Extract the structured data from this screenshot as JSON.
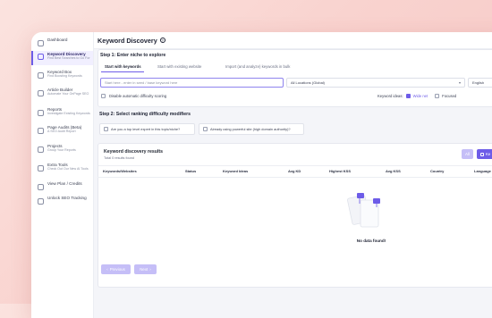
{
  "sidebar": {
    "items": [
      {
        "title": "Dashboard",
        "sub": ""
      },
      {
        "title": "Keyword Discovery",
        "sub": "Find Best Searches to Go For"
      },
      {
        "title": "Keyword Box",
        "sub": "Find Boosting Keywords"
      },
      {
        "title": "Article Builder",
        "sub": "Automate Your OnPage SEO"
      },
      {
        "title": "Reports",
        "sub": "Investigate Existing Keywords"
      },
      {
        "title": "Page Audits (Beta)",
        "sub": "A SEO Audit Report"
      },
      {
        "title": "Projects",
        "sub": "Group Your Reports"
      },
      {
        "title": "Extra Tools",
        "sub": "Check Out Our New AI Tools"
      },
      {
        "title": "View Plan / Credits",
        "sub": ""
      },
      {
        "title": "Unlock SEO Tracking",
        "sub": ""
      }
    ]
  },
  "header": {
    "title": "Keyword Discovery",
    "help": "?"
  },
  "step1": {
    "title": "Step 1: Enter niche to explore",
    "tabs": [
      {
        "label": "Start with keywords"
      },
      {
        "label": "Start with existing website"
      },
      {
        "label": "Import (and analyze) keywords in bulk"
      }
    ],
    "keyword_placeholder": "Start here - enter in seed / base keyword here",
    "location_value": "All Locations (Global)",
    "language_value": "English",
    "auto_difficulty_label": "Disable automatic difficulty scoring",
    "keyword_ideas_label": "Keyword ideas:",
    "wide_net_label": "Wide net",
    "focused_label": "Focused"
  },
  "step2": {
    "title": "Step 2: Select ranking difficulty modifiers",
    "expert_label": "Are you a top level expert in this topic/niche?",
    "authority_label": "Already using powerful site (high domain authority)?"
  },
  "results": {
    "title": "Keyword discovery results",
    "subtitle": "Total 0 results found",
    "all_button": "All",
    "action_button": "Ke",
    "columns": [
      "Keywords/Websites",
      "Status",
      "Keyword Ideas",
      "Avg KD",
      "Highest KSS",
      "Avg KSS",
      "Country",
      "Language"
    ],
    "empty_text": "No data found!",
    "prev_button": "Previous",
    "next_button": "Next"
  },
  "colors": {
    "accent": "#6d5ce8",
    "accent_light": "#c5bef7",
    "background": "#f4f5f9"
  }
}
